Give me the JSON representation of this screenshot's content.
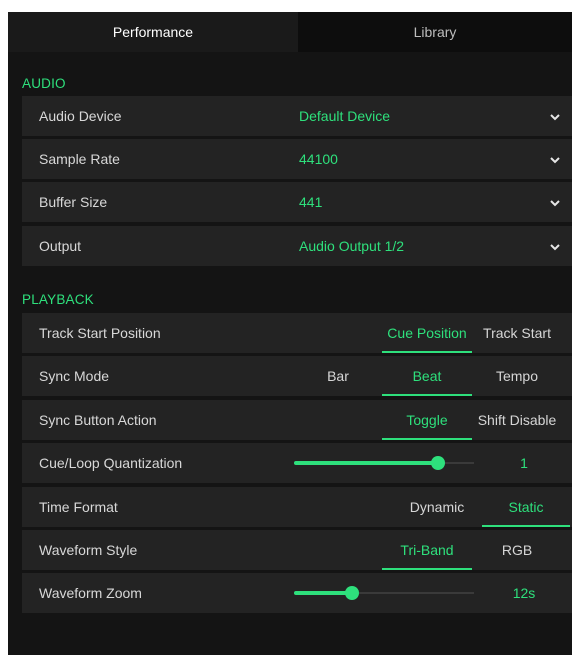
{
  "tabs": [
    {
      "label": "Performance",
      "active": true
    },
    {
      "label": "Library",
      "active": false
    }
  ],
  "audio": {
    "title": "AUDIO",
    "rows": [
      {
        "label": "Audio Device",
        "value": "Default Device",
        "icon": "chevron-down-icon"
      },
      {
        "label": "Sample Rate",
        "value": "44100",
        "icon": "chevron-down-icon"
      },
      {
        "label": "Buffer Size",
        "value": "441",
        "icon": "chevron-down-icon"
      },
      {
        "label": "Output",
        "value": "Audio Output 1/2",
        "icon": "chevron-down-icon"
      }
    ]
  },
  "playback": {
    "title": "PLAYBACK",
    "track_start_position": {
      "label": "Track Start Position",
      "options": [
        "Cue Position",
        "Track Start"
      ],
      "selected": "Cue Position"
    },
    "sync_mode": {
      "label": "Sync Mode",
      "options": [
        "Bar",
        "Beat",
        "Tempo"
      ],
      "selected": "Beat"
    },
    "sync_button_action": {
      "label": "Sync Button Action",
      "options": [
        "Toggle",
        "Shift Disable"
      ],
      "selected": "Toggle"
    },
    "cue_loop_quantization": {
      "label": "Cue/Loop Quantization",
      "value": "1",
      "slider_fraction": 0.8
    },
    "time_format": {
      "label": "Time Format",
      "options": [
        "Dynamic",
        "Static"
      ],
      "selected": "Static"
    },
    "waveform_style": {
      "label": "Waveform Style",
      "options": [
        "Tri-Band",
        "RGB"
      ],
      "selected": "Tri-Band"
    },
    "waveform_zoom": {
      "label": "Waveform Zoom",
      "value": "12s",
      "slider_fraction": 0.32
    }
  },
  "colors": {
    "accent": "#2ee07c",
    "background": "#141414",
    "row": "#232323",
    "text": "#d8d8d8"
  }
}
